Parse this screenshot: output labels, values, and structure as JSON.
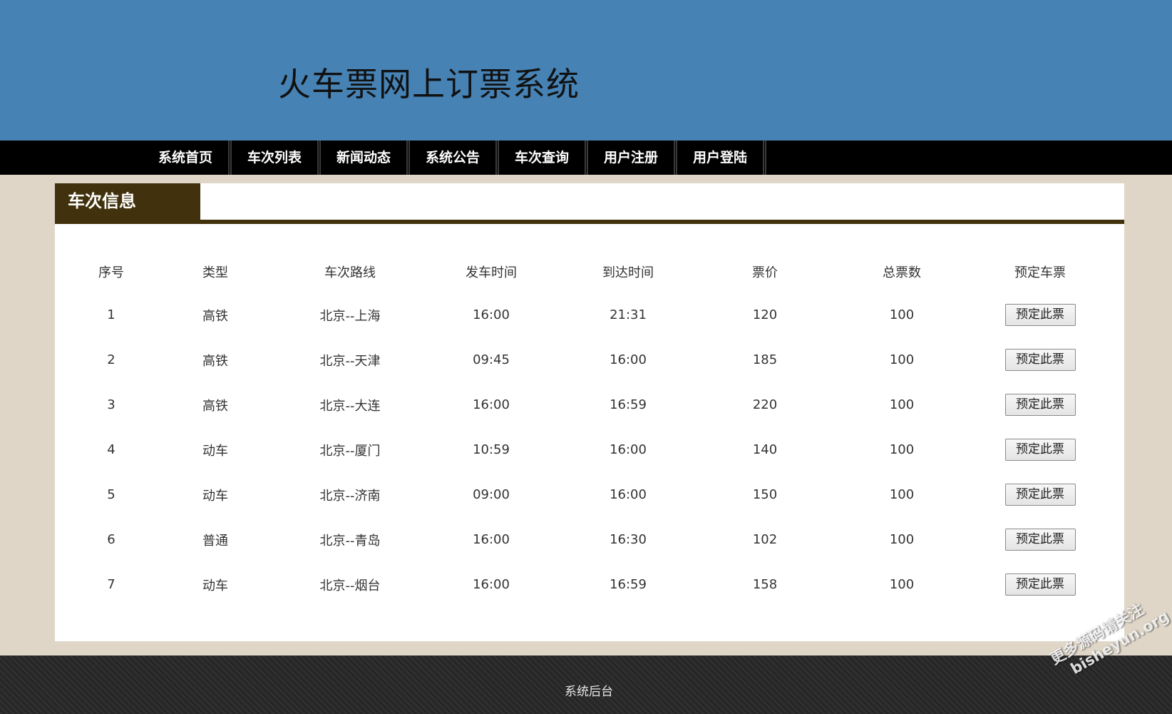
{
  "header": {
    "title": "火车票网上订票系统"
  },
  "nav": {
    "items": [
      "系统首页",
      "车次列表",
      "新闻动态",
      "系统公告",
      "车次查询",
      "用户注册",
      "用户登陆"
    ]
  },
  "panel": {
    "title": "车次信息"
  },
  "table": {
    "columns": [
      "序号",
      "类型",
      "车次路线",
      "发车时间",
      "到达时间",
      "票价",
      "总票数",
      "预定车票"
    ],
    "button_label": "预定此票",
    "rows": [
      {
        "id": "1",
        "type": "高铁",
        "route": "北京--上海",
        "depart": "16:00",
        "arrive": "21:31",
        "price": "120",
        "total": "100"
      },
      {
        "id": "2",
        "type": "高铁",
        "route": "北京--天津",
        "depart": "09:45",
        "arrive": "16:00",
        "price": "185",
        "total": "100"
      },
      {
        "id": "3",
        "type": "高铁",
        "route": "北京--大连",
        "depart": "16:00",
        "arrive": "16:59",
        "price": "220",
        "total": "100"
      },
      {
        "id": "4",
        "type": "动车",
        "route": "北京--厦门",
        "depart": "10:59",
        "arrive": "16:00",
        "price": "140",
        "total": "100"
      },
      {
        "id": "5",
        "type": "动车",
        "route": "北京--济南",
        "depart": "09:00",
        "arrive": "16:00",
        "price": "150",
        "total": "100"
      },
      {
        "id": "6",
        "type": "普通",
        "route": "北京--青岛",
        "depart": "16:00",
        "arrive": "16:30",
        "price": "102",
        "total": "100"
      },
      {
        "id": "7",
        "type": "动车",
        "route": "北京--烟台",
        "depart": "16:00",
        "arrive": "16:59",
        "price": "158",
        "total": "100"
      }
    ]
  },
  "footer": {
    "link": "系统后台"
  },
  "watermark": {
    "line1": "更多源码请关注",
    "line2": "bisheyun.org"
  },
  "colors": {
    "header_bg": "#4682b4",
    "nav_bg": "#000000",
    "page_bg": "#dfd6c8",
    "panel_accent": "#41320d"
  }
}
